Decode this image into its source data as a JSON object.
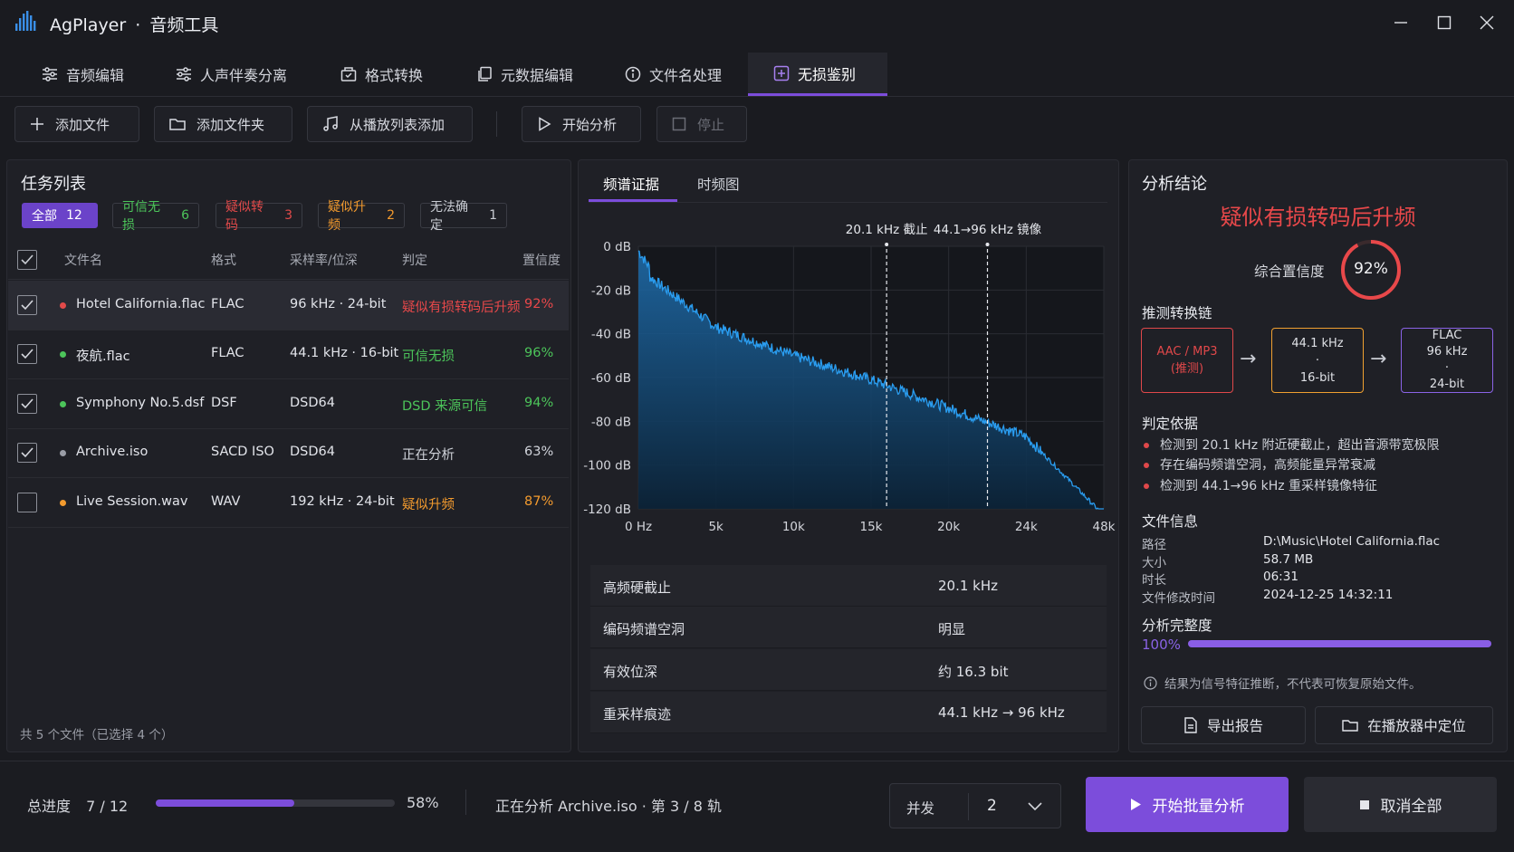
{
  "window": {
    "app_name": "AgPlayer",
    "separator": "·",
    "subtitle": "音频工具"
  },
  "tabs": [
    {
      "label": "音频编辑",
      "icon": "sliders-icon"
    },
    {
      "label": "人声伴奏分离",
      "icon": "mixer-icon"
    },
    {
      "label": "格式转换",
      "icon": "convert-icon"
    },
    {
      "label": "元数据编辑",
      "icon": "copy-icon"
    },
    {
      "label": "文件名处理",
      "icon": "info-icon"
    },
    {
      "label": "无损鉴别",
      "icon": "detect-icon",
      "active": true
    }
  ],
  "toolbar": {
    "add_file": "添加文件",
    "add_folder": "添加文件夹",
    "add_from_playlist": "从播放列表添加",
    "start_analysis": "开始分析",
    "stop": "停止"
  },
  "task_list": {
    "title": "任务列表",
    "filters": [
      {
        "label": "全部",
        "count": "12",
        "color": "#ffffff"
      },
      {
        "label": "可信无损",
        "count": "6",
        "color": "#4cc45a"
      },
      {
        "label": "疑似转码",
        "count": "3",
        "color": "#e24a4a"
      },
      {
        "label": "疑似升频",
        "count": "2",
        "color": "#f29a2e"
      },
      {
        "label": "无法确定",
        "count": "1",
        "color": "#c9ccd3"
      }
    ],
    "columns": {
      "name": "文件名",
      "format": "格式",
      "rate": "采样率/位深",
      "verdict": "判定",
      "confidence": "置信度"
    },
    "rows": [
      {
        "checked": true,
        "dot": "#e24a4a",
        "name": "Hotel California.flac",
        "format": "FLAC",
        "rate": "96 kHz · 24-bit",
        "verdict": "疑似有损转码后升频",
        "confidence": "92%",
        "verdict_color": "#e8484a",
        "conf_color": "#e8484a",
        "selected": true
      },
      {
        "checked": true,
        "dot": "#4cc45a",
        "name": "夜航.flac",
        "format": "FLAC",
        "rate": "44.1 kHz · 16-bit",
        "verdict": "可信无损",
        "confidence": "96%",
        "verdict_color": "#4cc45a",
        "conf_color": "#4cc45a"
      },
      {
        "checked": true,
        "dot": "#4cc45a",
        "name": "Symphony No.5.dsf",
        "format": "DSF",
        "rate": "DSD64",
        "verdict": "DSD 来源可信",
        "confidence": "94%",
        "verdict_color": "#4cc45a",
        "conf_color": "#4cc45a"
      },
      {
        "checked": true,
        "dot": "#9a9da6",
        "name": "Archive.iso",
        "format": "SACD ISO",
        "rate": "DSD64",
        "verdict": "正在分析",
        "confidence": "63%",
        "verdict_color": "#d0d3da",
        "conf_color": "#d0d3da"
      },
      {
        "checked": false,
        "dot": "#f29a2e",
        "name": "Live Session.wav",
        "format": "WAV",
        "rate": "192 kHz · 24-bit",
        "verdict": "疑似升频",
        "confidence": "87%",
        "verdict_color": "#f29a2e",
        "conf_color": "#f29a2e"
      }
    ],
    "footer": "共 5 个文件（已选择 4 个）"
  },
  "spectrum": {
    "tabs": [
      "频谱证据",
      "时频图"
    ],
    "markers": [
      "20.1 kHz 截止",
      "44.1→96 kHz 镜像"
    ],
    "y_ticks": [
      "0 dB",
      "-20 dB",
      "-40 dB",
      "-60 dB",
      "-80 dB",
      "-100 dB",
      "-120 dB"
    ],
    "x_ticks": [
      "0 Hz",
      "5k",
      "10k",
      "15k",
      "20k",
      "24k",
      "48k"
    ],
    "stats": [
      {
        "key": "高频硬截止",
        "value": "20.1 kHz"
      },
      {
        "key": "编码频谱空洞",
        "value": "明显"
      },
      {
        "key": "有效位深",
        "value": "约 16.3 bit"
      },
      {
        "key": "重采样痕迹",
        "value": "44.1 kHz → 96 kHz"
      }
    ]
  },
  "chart_data": {
    "type": "area",
    "x_ticks": [
      "0 Hz",
      "5k",
      "10k",
      "15k",
      "20k",
      "24k",
      "48k"
    ],
    "ylim": [
      -120,
      0
    ],
    "y_ticks": [
      0,
      -20,
      -40,
      -60,
      -80,
      -100,
      -120
    ],
    "series": [
      {
        "x": [
          "0 Hz",
          "5k",
          "10k",
          "15k",
          "20k",
          "24k",
          "48k"
        ],
        "values": [
          -10,
          -37,
          -50,
          -61,
          -74,
          -87,
          -123
        ]
      }
    ],
    "annotations": [
      "20.1 kHz 截止",
      "44.1→96 kHz 镜像"
    ],
    "color": "#2a9df0",
    "grid": true
  },
  "conclusion": {
    "title": "分析结论",
    "verdict": "疑似有损转码后升频",
    "confidence_label": "综合置信度",
    "confidence": "92%",
    "confidence_value": 0.92,
    "chain_title": "推测转换链",
    "chain": [
      {
        "line1": "AAC / MP3",
        "line2": "(推测)",
        "color": "#e0484a"
      },
      {
        "line1": "44.1 kHz",
        "line2": "·",
        "line3": "16-bit",
        "color": "#f0a030"
      },
      {
        "line1": "FLAC",
        "line2": "96 kHz",
        "line3": "·",
        "line4": "24-bit",
        "color": "#8a63e6"
      }
    ],
    "basis_title": "判定依据",
    "basis": [
      "检测到 20.1 kHz 附近硬截止，超出音源带宽极限",
      "存在编码频谱空洞，高频能量异常衰减",
      "检测到 44.1→96 kHz 重采样镜像特征"
    ],
    "file_info_title": "文件信息",
    "file_info": [
      {
        "key": "路径",
        "value": "D:\\Music\\Hotel California.flac"
      },
      {
        "key": "大小",
        "value": "58.7 MB"
      },
      {
        "key": "时长",
        "value": "06:31"
      },
      {
        "key": "文件修改时间",
        "value": "2024-12-25  14:32:11"
      }
    ],
    "integrity_title": "分析完整度",
    "integrity": "100%",
    "integrity_value": 1.0,
    "note": "结果为信号特征推断，不代表可恢复原始文件。",
    "export_report": "导出报告",
    "locate_in_player": "在播放器中定位"
  },
  "bottom": {
    "progress_label": "总进度",
    "progress_count": "7 / 12",
    "progress_percent": "58%",
    "progress_value": 0.58,
    "status": "正在分析 Archive.iso · 第 3 / 8 轨",
    "concurrency_label": "并发",
    "concurrency_value": "2",
    "start_batch": "开始批量分析",
    "cancel_all": "取消全部"
  },
  "colors": {
    "accent": "#7c4ddb",
    "danger": "#e8484a",
    "success": "#4cc45a",
    "warning": "#f29a2e",
    "spectrum": "#2a9df0"
  }
}
